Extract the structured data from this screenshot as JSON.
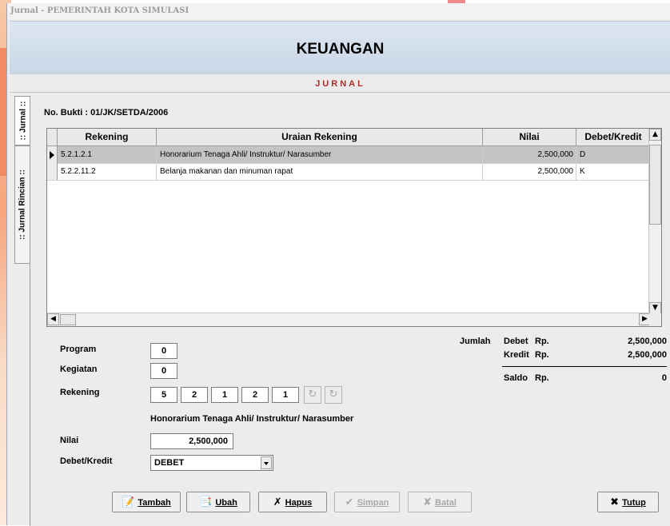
{
  "window": {
    "title": "Jurnal - PEMERINTAH KOTA SIMULASI"
  },
  "header": {
    "title": "KEUANGAN",
    "subtitle": "JURNAL"
  },
  "tabs": [
    {
      "label": ":: Jurnal ::",
      "active": true
    },
    {
      "label": ":: Jurnal Rincian ::",
      "active": false
    }
  ],
  "no_bukti": {
    "label": "No. Bukti",
    "value": ": 01/JK/SETDA/2006"
  },
  "grid": {
    "columns": [
      "Rekening",
      "Uraian Rekening",
      "Nilai",
      "Debet/Kredit"
    ],
    "rows": [
      {
        "rekening": "5.2.1.2.1",
        "uraian": "Honorarium Tenaga Ahli/ Instruktur/ Narasumber",
        "nilai": "2,500,000",
        "dk": "D",
        "selected": true
      },
      {
        "rekening": "5.2.2.11.2",
        "uraian": "Belanja makanan dan minuman rapat",
        "nilai": "2,500,000",
        "dk": "K",
        "selected": false
      }
    ]
  },
  "form": {
    "program_label": "Program",
    "program_value": "0",
    "kegiatan_label": "Kegiatan",
    "kegiatan_value": "0",
    "rekening_label": "Rekening",
    "rekening_parts": [
      "5",
      "2",
      "1",
      "2",
      "1"
    ],
    "rekening_desc": "Honorarium Tenaga Ahli/ Instruktur/ Narasumber",
    "nilai_label": "Nilai",
    "nilai_value": "2,500,000",
    "dk_label": "Debet/Kredit",
    "dk_value": "DEBET"
  },
  "summary": {
    "jumlah_label": "Jumlah",
    "debet_label": "Debet",
    "kredit_label": "Kredit",
    "saldo_label": "Saldo",
    "currency": "Rp.",
    "debet_value": "2,500,000",
    "kredit_value": "2,500,000",
    "saldo_value": "0"
  },
  "buttons": {
    "tambah": "Tambah",
    "ubah": "Ubah",
    "hapus": "Hapus",
    "simpan": "Simpan",
    "batal": "Batal",
    "tutup": "Tutup"
  },
  "colors": {
    "subtitle": "#b22a2a",
    "header_bg": "#d3deeb",
    "selected_row": "#c4c4c4"
  }
}
